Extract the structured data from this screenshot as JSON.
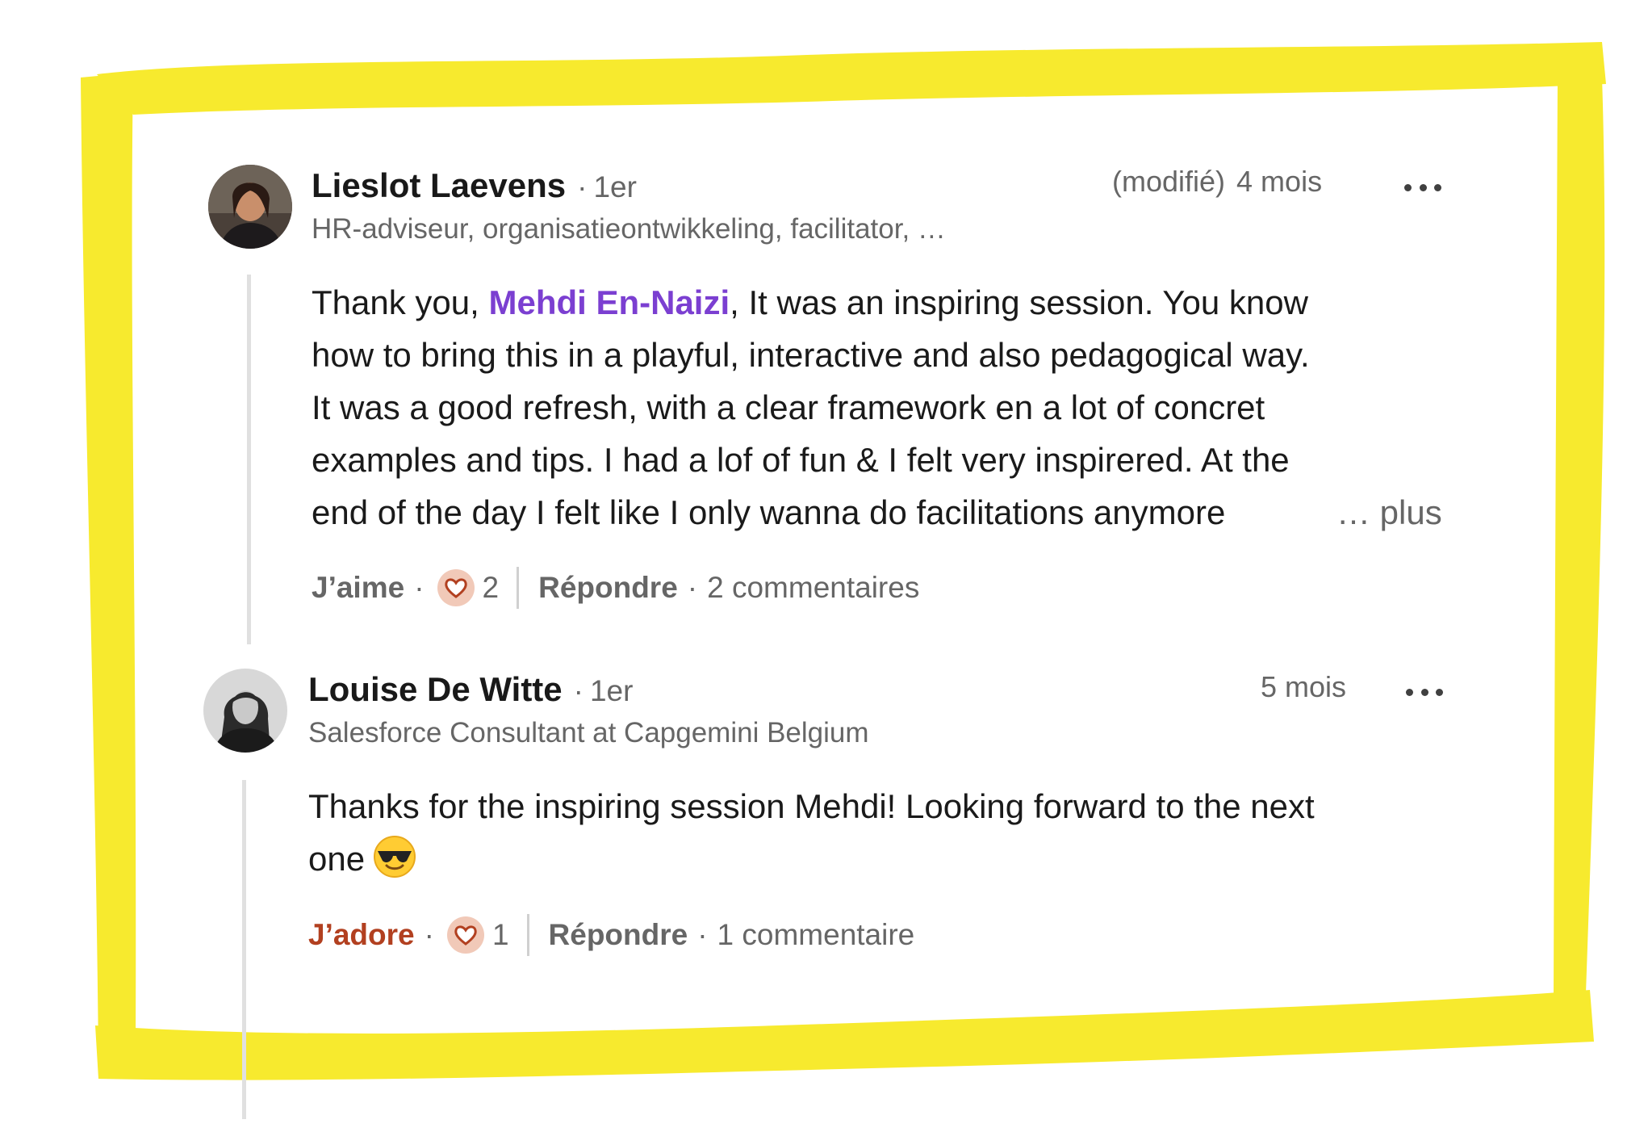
{
  "frame": {
    "color": "#f7ea2e"
  },
  "comments": [
    {
      "author": "Lieslot Laevens",
      "degree": "1er",
      "headline": "HR-adviseur, organisatieontwikkeling, facilitator, …",
      "edited": "(modifié)",
      "time": "4 mois",
      "text": {
        "l1_before": "Thank you, ",
        "l1_mention": "Mehdi En-Naizi",
        "l1_after": ", It was an inspiring session. You know",
        "l2": "how to bring this in a playful, interactive and also pedagogical way.",
        "l3": "It was a good refresh, with a clear framework en a lot of concret",
        "l4": "examples and tips. I had a lof of fun & I felt very inspirered. At the",
        "l5": "end of the day I felt like I only wanna do facilitations anymore",
        "see_more": "… plus"
      },
      "like_label": "J’aime",
      "reaction_icon": "heart-icon",
      "reaction_count": "2",
      "reply_label": "Répondre",
      "replies": "2 commentaires"
    },
    {
      "author": "Louise De Witte",
      "degree": "1er",
      "headline": "Salesforce Consultant at Capgemini Belgium",
      "time": "5 mois",
      "text": {
        "l1": "Thanks for the inspiring session Mehdi! Looking forward to the next",
        "l2": "one"
      },
      "emoji": "smiling-face-with-sunglasses",
      "like_label": "J’adore",
      "like_color": "#b24020",
      "reaction_icon": "heart-icon",
      "reaction_count": "1",
      "reply_label": "Répondre",
      "replies": "1 commentaire"
    }
  ]
}
